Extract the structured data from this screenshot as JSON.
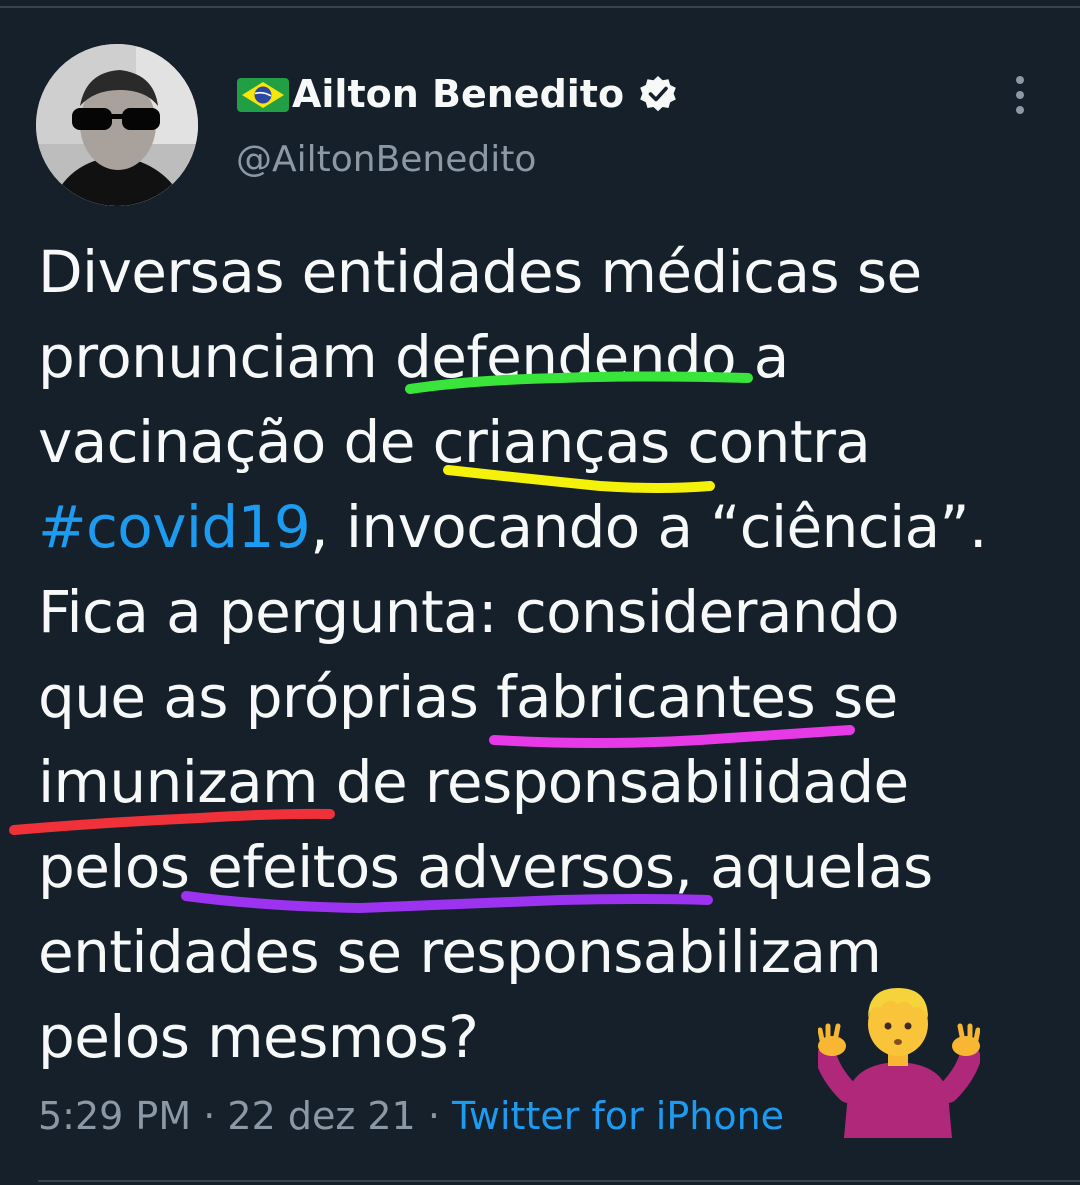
{
  "author": {
    "display_name": "Ailton Benedito",
    "handle": "@AiltonBenedito",
    "verified": true,
    "flag_icon": "brazil-flag-emoji"
  },
  "tweet": {
    "lines": [
      "Diversas entidades médicas se",
      "pronunciam defendendo a",
      "vacinação de crianças contra",
      ", invocando a “ciência”.",
      "Fica a pergunta: considerando",
      "que as próprias fabricantes se",
      "imunizam de responsabilidade",
      "pelos efeitos adversos, aquelas",
      "entidades se responsabilizam",
      "pelos mesmos?"
    ],
    "hashtag": "#covid19",
    "emoji": "man-shrugging-emoji"
  },
  "meta": {
    "time": "5:29 PM",
    "separator": "·",
    "date": "22 dez 21",
    "source": "Twitter for iPhone"
  },
  "colors": {
    "background": "#15202b",
    "text": "#f7f9f9",
    "secondary": "#8b98a5",
    "accent": "#1d9bf0",
    "underline_green": "#39e53b",
    "underline_yellow": "#f4f10a",
    "underline_magenta": "#e63ae6",
    "underline_red": "#f0313a",
    "underline_purple": "#9b33f0"
  }
}
